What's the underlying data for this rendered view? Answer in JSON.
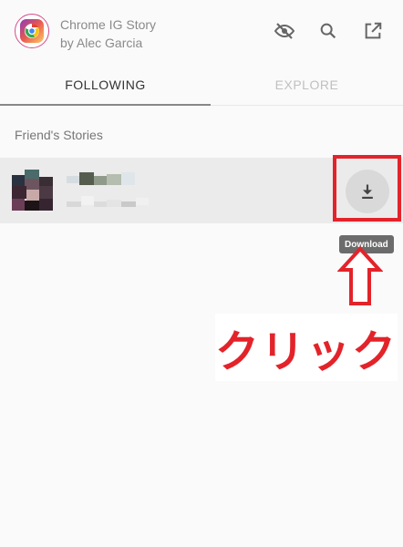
{
  "app": {
    "title": "Chrome IG Story",
    "subtitle": "by Alec Garcia",
    "logo_icon": "chrome-ig-story-logo"
  },
  "header_actions": [
    {
      "name": "hide-icon",
      "icon": "eye-off"
    },
    {
      "name": "search-icon",
      "icon": "search"
    },
    {
      "name": "open-external-icon",
      "icon": "open-in-new"
    }
  ],
  "tabs": [
    {
      "label": "FOLLOWING",
      "active": true
    },
    {
      "label": "EXPLORE",
      "active": false
    }
  ],
  "section": {
    "label": "Friend's Stories"
  },
  "story": {
    "download_icon": "download",
    "tooltip": "Download"
  },
  "annotation": {
    "text": "クリック",
    "color": "#e3232a"
  },
  "colors": {
    "accent_red": "#e3232a",
    "tab_active": "#333333",
    "tab_inactive": "#c0c0c0",
    "row_bg": "#ebebeb"
  }
}
